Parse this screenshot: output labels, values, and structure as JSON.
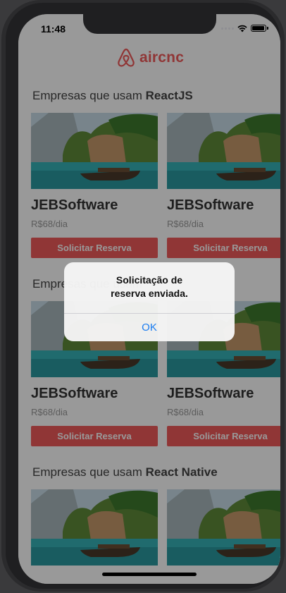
{
  "status_bar": {
    "time": "11:48"
  },
  "header": {
    "logo_text": "aircnc"
  },
  "sections": [
    {
      "prefix": "Empresas que usam ",
      "tech": "ReactJS"
    },
    {
      "prefix": "Empresas que usam ",
      "tech": ""
    },
    {
      "prefix": "Empresas que usam ",
      "tech": "React Native"
    }
  ],
  "cards": [
    {
      "name": "JEBSoftware",
      "price": "R$68/dia",
      "button": "Solicitar Reserva"
    },
    {
      "name": "JEBSoftware",
      "price": "R$68/dia",
      "button": "Solicitar Reserva"
    },
    {
      "name": "JEBSoftware",
      "price": "R$68/dia",
      "button": "Solicitar Reserva"
    },
    {
      "name": "JEBSoftware",
      "price": "R$68/dia",
      "button": "Solicitar Reserva"
    }
  ],
  "alert": {
    "line1": "Solicitação de",
    "line2": "reserva enviada.",
    "ok_label": "OK"
  },
  "colors": {
    "brand": "#f05a5b",
    "alert_button": "#1a7cf0"
  },
  "icons": [
    "airbnb-logo-icon",
    "cellular-signal-icon",
    "wifi-icon",
    "battery-icon"
  ]
}
